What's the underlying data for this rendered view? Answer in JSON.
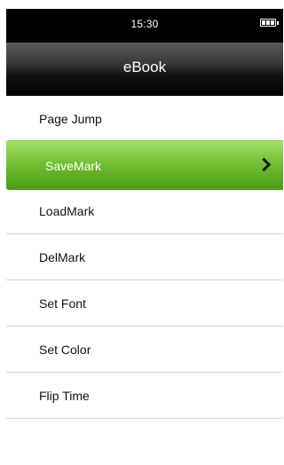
{
  "status": {
    "time": "15:30",
    "battery_icon": "battery-full-icon"
  },
  "header": {
    "title": "eBook"
  },
  "menu": {
    "items": [
      {
        "label": "Page  Jump"
      },
      {
        "label": "SaveMark",
        "selected": true,
        "icon": "chevron-right-icon"
      },
      {
        "label": "LoadMark"
      },
      {
        "label": "DelMark"
      },
      {
        "label": "Set  Font"
      },
      {
        "label": "Set  Color"
      },
      {
        "label": "Flip Time"
      }
    ]
  },
  "colors": {
    "selected_start": "#a6dd6b",
    "selected_end": "#4e9a17",
    "status_bar": "#000000"
  }
}
